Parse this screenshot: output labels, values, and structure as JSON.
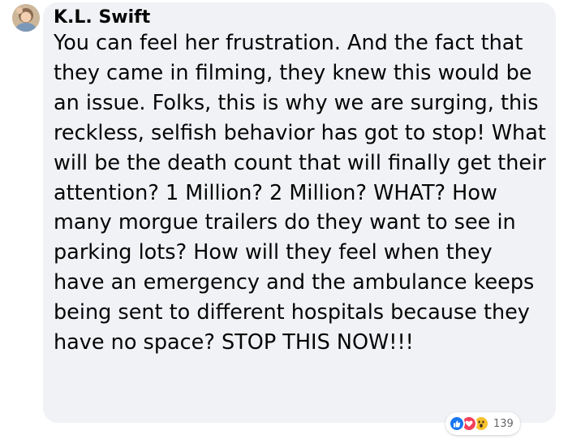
{
  "comment": {
    "author": "K.L. Swift",
    "text": "You can feel her frustration. And the fact that they came in filming, they knew this would be an issue. Folks, this is why we are surging, this reckless, selfish behavior has got to stop! What will be the death count that will finally get their attention? 1 Million? 2 Million? WHAT? How many morgue trailers do they want to see in parking lots? How will they feel when they have an emergency and the ambulance keeps being sent to different hospitals because they have no space? STOP THIS NOW!!!",
    "reactions": {
      "types": [
        "like-icon",
        "love-icon",
        "wow-icon"
      ],
      "count": "139"
    }
  },
  "colors": {
    "bubble": "#f0f2f5",
    "text": "#050505",
    "like": "#1877f2",
    "love": "#f33e58",
    "wow": "#f7c12e",
    "count": "#65676b"
  }
}
